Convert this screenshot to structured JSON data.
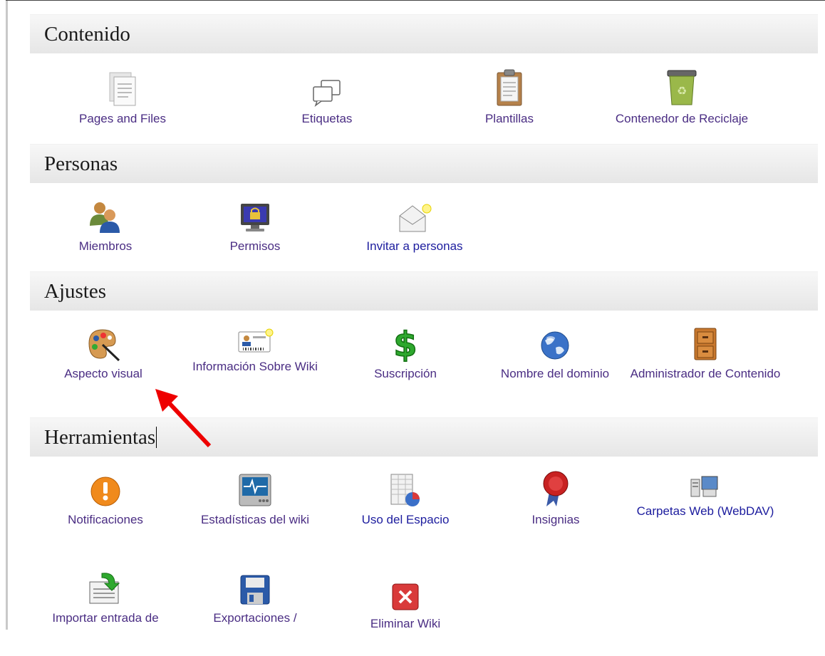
{
  "sections": {
    "contenido": {
      "title": "Contenido",
      "items": [
        {
          "label": "Pages and Files",
          "icon": "pages-files-icon"
        },
        {
          "label": "Etiquetas",
          "icon": "tags-icon"
        },
        {
          "label": "Plantillas",
          "icon": "templates-icon"
        },
        {
          "label": "Contenedor de Reciclaje",
          "icon": "recycle-bin-icon"
        }
      ]
    },
    "personas": {
      "title": "Personas",
      "items": [
        {
          "label": "Miembros",
          "icon": "members-icon"
        },
        {
          "label": "Permisos",
          "icon": "permissions-icon"
        },
        {
          "label": "Invitar a personas",
          "icon": "invite-icon"
        }
      ]
    },
    "ajustes": {
      "title": "Ajustes",
      "items": [
        {
          "label": "Aspecto visual",
          "icon": "palette-icon"
        },
        {
          "label": "Información Sobre Wiki",
          "icon": "id-card-icon"
        },
        {
          "label": "Suscripción",
          "icon": "dollar-icon"
        },
        {
          "label": "Nombre del dominio",
          "icon": "globe-icon"
        },
        {
          "label": "Administrador de Contenido",
          "icon": "cabinet-icon"
        }
      ]
    },
    "herramientas": {
      "title": "Herramientas",
      "items": [
        {
          "label": "Notificaciones",
          "icon": "alert-icon"
        },
        {
          "label": "Estadísticas del wiki",
          "icon": "stats-monitor-icon"
        },
        {
          "label": "Uso del Espacio",
          "icon": "space-usage-icon"
        },
        {
          "label": "Insignias",
          "icon": "badge-icon"
        },
        {
          "label": "Carpetas Web (WebDAV)",
          "icon": "webdav-icon"
        },
        {
          "label": "Importar entrada de",
          "icon": "import-news-icon"
        },
        {
          "label": "Exportaciones /",
          "icon": "floppy-export-icon"
        },
        {
          "label": "Eliminar Wiki",
          "icon": "delete-icon"
        }
      ]
    }
  },
  "colors": {
    "link": "#4a2d83",
    "link_blue": "#1c1c9e",
    "header_bg": "#ececec",
    "annotation_arrow": "#ee0000"
  }
}
